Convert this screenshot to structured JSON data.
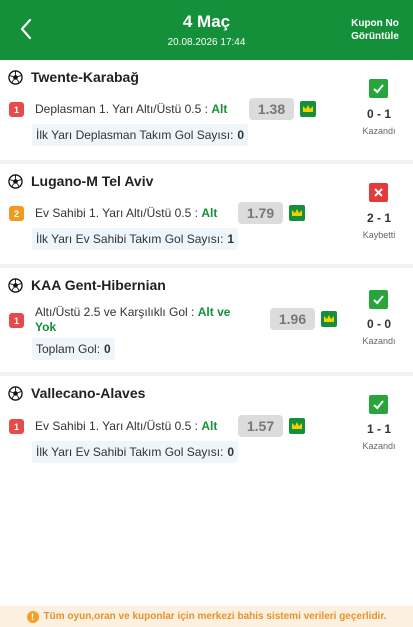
{
  "header": {
    "title": "4 Maç",
    "date": "20.08.2026 17:44",
    "kupon_no_line1": "Kupon No",
    "kupon_no_line2": "Görüntüle"
  },
  "colors": {
    "brand_green": "#14903a",
    "win_green": "#28a43c",
    "lose_red": "#e23b3b",
    "badge_red": "#e84a4a",
    "badge_orange": "#f09a20",
    "warning_orange": "#e6912a"
  },
  "icons": {
    "back": "chevron-left-icon",
    "match": "soccer-ball-icon",
    "odd_marker": "crown-icon",
    "win": "check-icon",
    "lose": "cross-icon",
    "footer": "info-icon"
  },
  "matches": [
    {
      "title": "Twente-Karabağ",
      "badge": "1",
      "bet_prefix": "Deplasman 1. Yarı Altı/Üstü 0.5 : ",
      "bet_selection": "Alt",
      "odd": "1.38",
      "info_label": "İlk Yarı Deplasman Takım Gol Sayısı:",
      "info_value": "0",
      "score": "0 - 1",
      "result": "Kazandı",
      "won": true
    },
    {
      "title": "Lugano-M Tel Aviv",
      "badge": "2",
      "bet_prefix": "Ev Sahibi 1. Yarı Altı/Üstü 0.5 : ",
      "bet_selection": "Alt",
      "odd": "1.79",
      "info_label": "İlk Yarı Ev Sahibi Takım Gol Sayısı:",
      "info_value": "1",
      "score": "2 - 1",
      "result": "Kaybetti",
      "won": false
    },
    {
      "title": "KAA Gent-Hibernian",
      "badge": "1",
      "bet_prefix": "Altı/Üstü 2.5 ve Karşılıklı Gol : ",
      "bet_selection": "Alt ve Yok",
      "odd": "1.96",
      "info_label": "Toplam Gol:",
      "info_value": "0",
      "score": "0 - 0",
      "result": "Kazandı",
      "won": true
    },
    {
      "title": "Vallecano-Alaves",
      "badge": "1",
      "bet_prefix": "Ev Sahibi 1. Yarı Altı/Üstü 0.5 : ",
      "bet_selection": "Alt",
      "odd": "1.57",
      "info_label": "İlk Yarı Ev Sahibi Takım Gol Sayısı:",
      "info_value": "0",
      "score": "1 - 1",
      "result": "Kazandı",
      "won": true
    }
  ],
  "footer": {
    "notice": "Tüm oyun,oran ve kuponlar için merkezi bahis sistemi verileri geçerlidir."
  }
}
